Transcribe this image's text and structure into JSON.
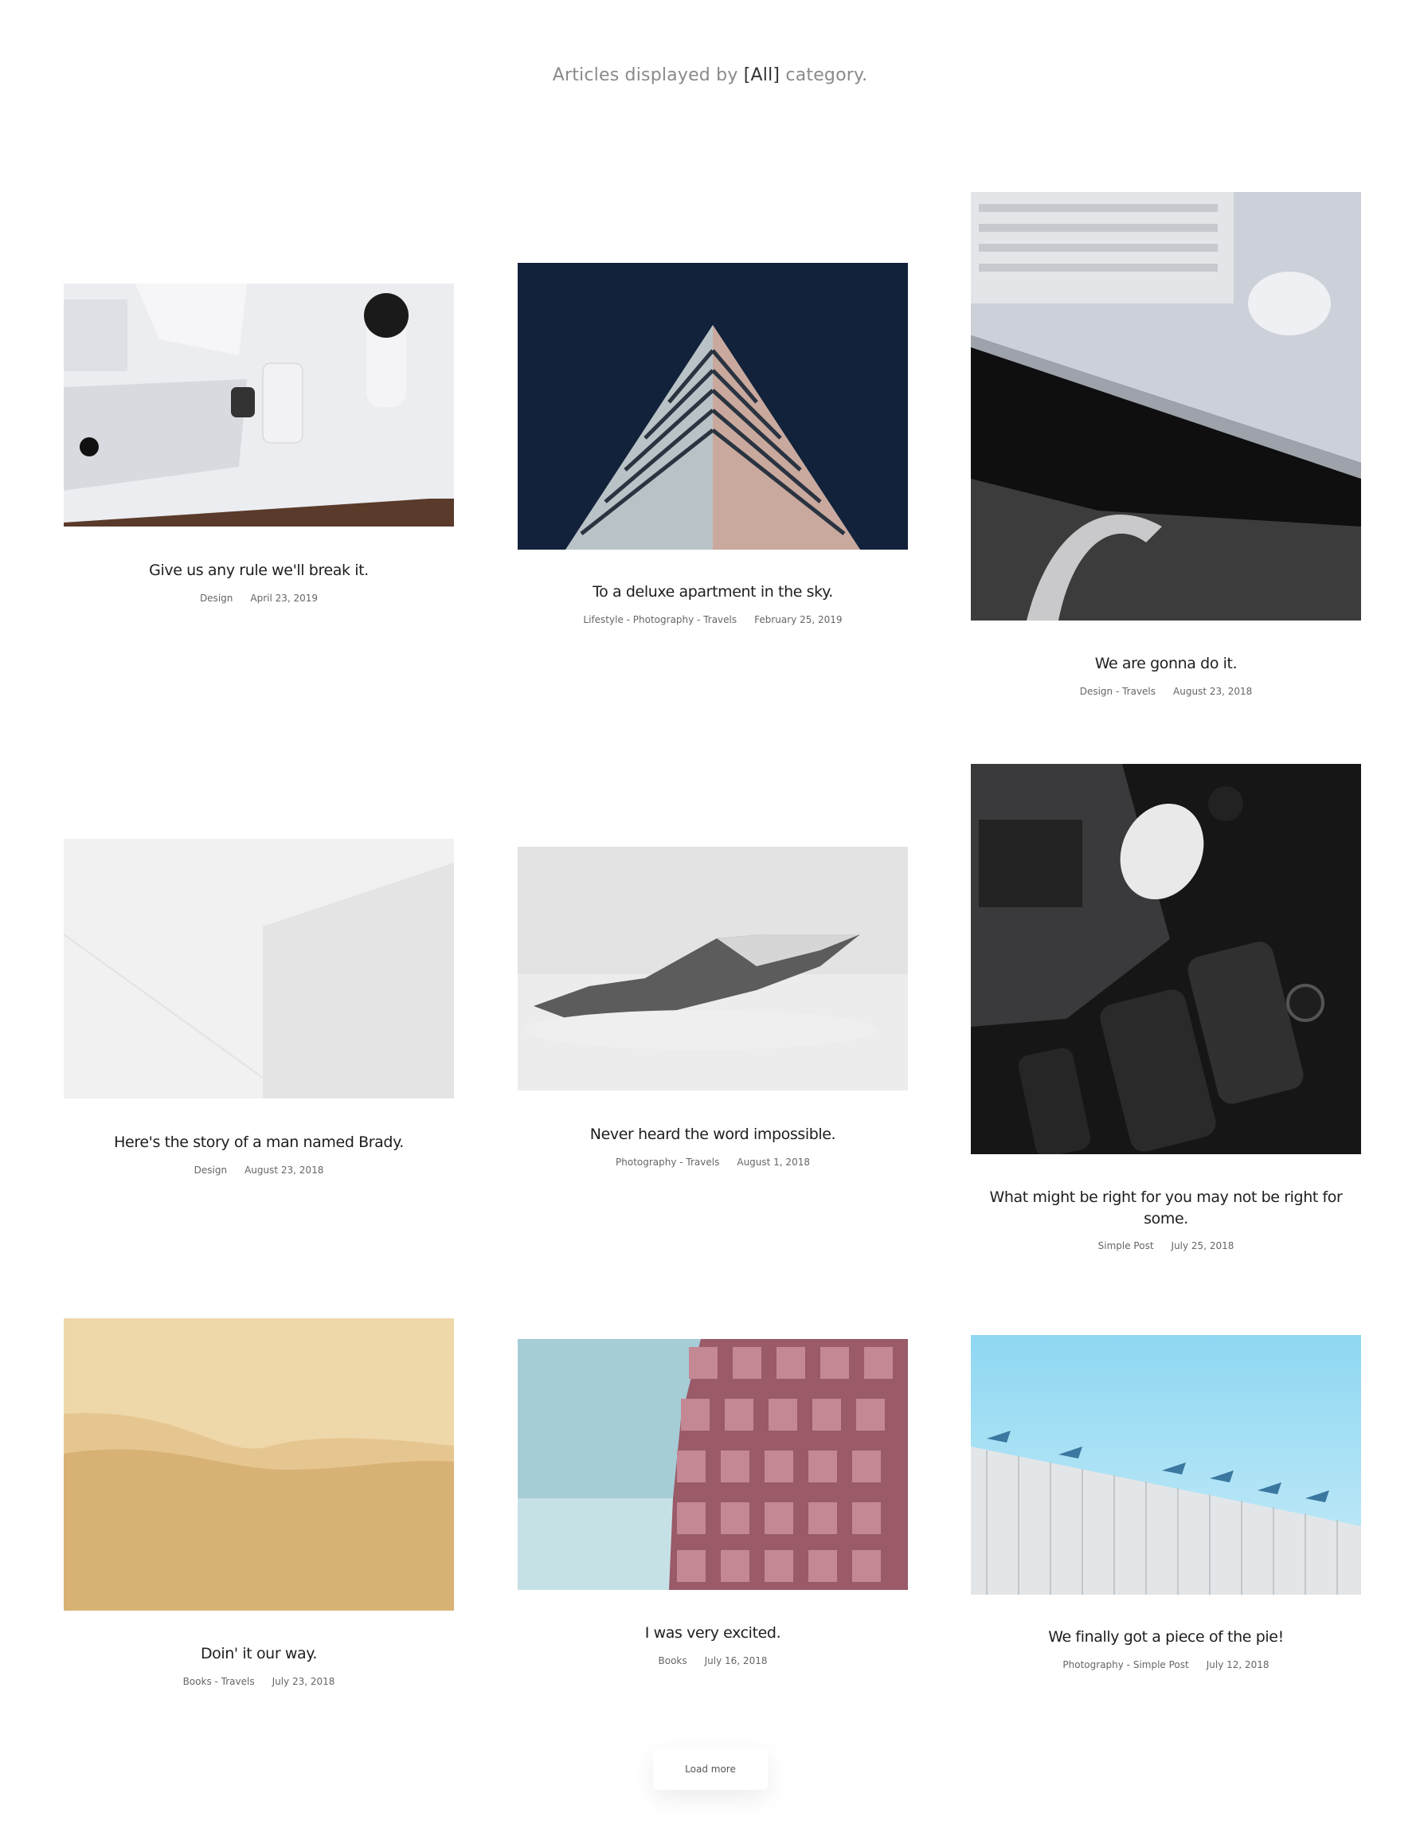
{
  "header": {
    "prefix": "Articles displayed by ",
    "category": "[All]",
    "suffix": " category."
  },
  "articles": [
    {
      "title": "Give us any rule we'll break it.",
      "categories": "Design",
      "date": "April 23, 2019"
    },
    {
      "title": "To a deluxe apartment in the sky.",
      "categories": "Lifestyle - Photography - Travels",
      "date": "February 25, 2019"
    },
    {
      "title": "We are gonna do it.",
      "categories": "Design - Travels",
      "date": "August 23, 2018"
    },
    {
      "title": "Here's the story of a man named Brady.",
      "categories": "Design",
      "date": "August 23, 2018"
    },
    {
      "title": "Never heard the word impossible.",
      "categories": "Photography - Travels",
      "date": "August 1, 2018"
    },
    {
      "title": "What might be right for you may not be right for some.",
      "categories": "Simple Post",
      "date": "July 25, 2018"
    },
    {
      "title": "Doin' it our way.",
      "categories": "Books - Travels",
      "date": "July 23, 2018"
    },
    {
      "title": "I was very excited.",
      "categories": "Books",
      "date": "July 16, 2018"
    },
    {
      "title": "We finally got a piece of the pie!",
      "categories": "Photography - Simple Post",
      "date": "July 12, 2018"
    }
  ],
  "load_more": {
    "label": "Load more"
  }
}
